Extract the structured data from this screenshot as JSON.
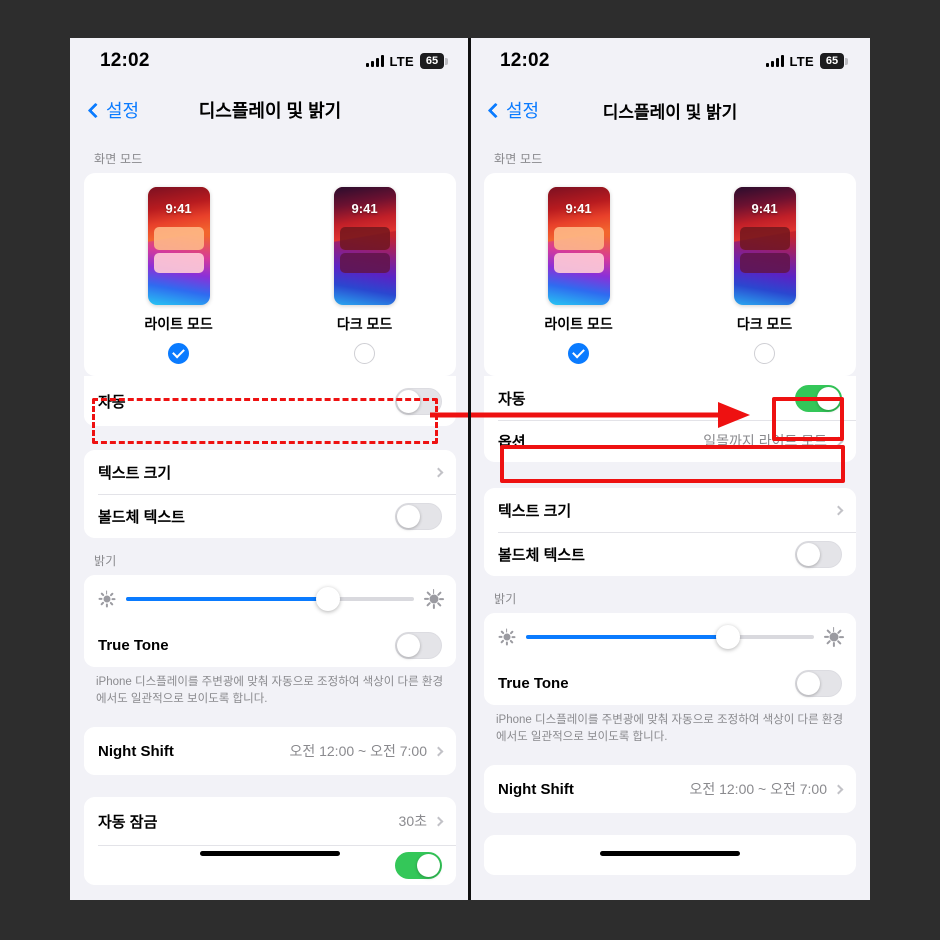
{
  "background_color": "#2d2d2d",
  "accent_blue": "#0a7bff",
  "toggle_on_color": "#34c759",
  "annotation_color": "#ee1111",
  "status_bar": {
    "time": "12:02",
    "network": "LTE",
    "battery": "65",
    "signal_icon": "cellular-bars-icon",
    "battery_icon": "battery-icon"
  },
  "nav": {
    "back_label": "설정",
    "back_icon": "chevron-left-icon",
    "title": "디스플레이 및 밝기"
  },
  "display_mode": {
    "section_label": "화면 모드",
    "phone_time": "9:41",
    "options": [
      {
        "name": "라이트 모드",
        "selected": true
      },
      {
        "name": "다크 모드",
        "selected": false
      }
    ]
  },
  "auto_row": {
    "label": "자동",
    "left_state": "off",
    "right_state": "on"
  },
  "option_row": {
    "label": "옵션",
    "value": "일몰까지 라이트 모드",
    "chevron_icon": "chevron-right-icon"
  },
  "text_section": {
    "text_size": {
      "label": "텍스트 크기",
      "chevron_icon": "chevron-right-icon"
    },
    "bold_text": {
      "label": "볼드체 텍스트",
      "state": "off"
    }
  },
  "brightness": {
    "section_label": "밝기",
    "low_icon": "brightness-low-icon",
    "high_icon": "brightness-high-icon",
    "value_percent": 70,
    "true_tone": {
      "label": "True Tone",
      "state": "off"
    },
    "footnote": "iPhone 디스플레이를 주변광에 맞춰 자동으로 조정하여 색상이 다른 환경에서도 일관적으로 보이도록 합니다."
  },
  "night_shift": {
    "label": "Night Shift",
    "value": "오전 12:00 ~ 오전 7:00",
    "chevron_icon": "chevron-right-icon"
  },
  "auto_lock": {
    "label": "자동 잠금",
    "value": "30초",
    "chevron_icon": "chevron-right-icon"
  },
  "annotations": {
    "dashed_box_target": "자동",
    "arrow_icon": "arrow-right-icon",
    "solid_box_toggle_target": "자동",
    "solid_box_row_target": "옵션"
  }
}
